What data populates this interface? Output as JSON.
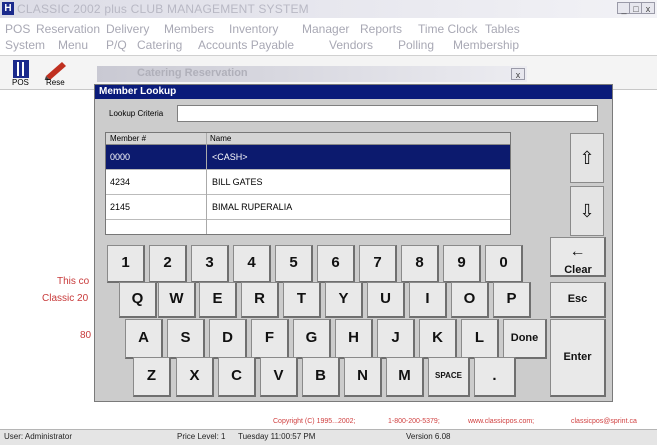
{
  "app": {
    "title": "CLASSIC 2002 plus CLUB MANAGEMENT SYSTEM",
    "icon_letter": "H"
  },
  "menu_row1": [
    "POS",
    "Reservation",
    "Delivery",
    "Members",
    "Inventory",
    "Manager",
    "Reports",
    "Time Clock",
    "Tables"
  ],
  "menu_row2": [
    "System",
    "Menu",
    "P/Q",
    "Catering",
    "Accounts Payable",
    "Vendors",
    "Polling",
    "Membership"
  ],
  "toolbar": {
    "pos_label": "POS",
    "res_label": "Rese"
  },
  "catering_window": {
    "title": "Catering Reservation",
    "close": "x"
  },
  "dialog": {
    "title": "Member Lookup",
    "lookup_label": "Lookup Criteria",
    "lookup_value": "",
    "columns": [
      "Member #",
      "Name"
    ],
    "rows": [
      {
        "id": "0000",
        "name": "<CASH>"
      },
      {
        "id": "4234",
        "name": "BILL GATES"
      },
      {
        "id": "2145",
        "name": "BIMAL RUPERALIA"
      }
    ],
    "selected_row": 0,
    "scroll_up": "⇧",
    "scroll_down": "⇩"
  },
  "keyboard": {
    "row_numbers": [
      "1",
      "2",
      "3",
      "4",
      "5",
      "6",
      "7",
      "8",
      "9",
      "0"
    ],
    "row_q": [
      "Q",
      "W",
      "E",
      "R",
      "T",
      "Y",
      "U",
      "I",
      "O",
      "P"
    ],
    "row_a": [
      "A",
      "S",
      "D",
      "F",
      "G",
      "H",
      "J",
      "K",
      "L"
    ],
    "row_z": [
      "Z",
      "X",
      "C",
      "V",
      "B",
      "N",
      "M"
    ],
    "backspace": "←",
    "clear": "Clear",
    "esc": "Esc",
    "done": "Done",
    "enter": "Enter",
    "space": "SPACE",
    "period": "."
  },
  "background_text": {
    "line1": "This co",
    "line2": "Classic 20",
    "line3": "80"
  },
  "footer": {
    "copyright": "Copyright (C) 1995...2002;",
    "phone": "1-800-200-5379;",
    "website": "www.classicpos.com;",
    "email": "classicpos@sprint.ca"
  },
  "status": {
    "user": "User: Administrator",
    "price_level": "Price Level: 1",
    "datetime": "Tuesday 11:00:57 PM",
    "version": "Version 6.08"
  },
  "colors": {
    "dialog_title_bg": "#0a1b7a",
    "selected_row_bg": "#0c1a6e",
    "footer_text": "#d04040"
  }
}
